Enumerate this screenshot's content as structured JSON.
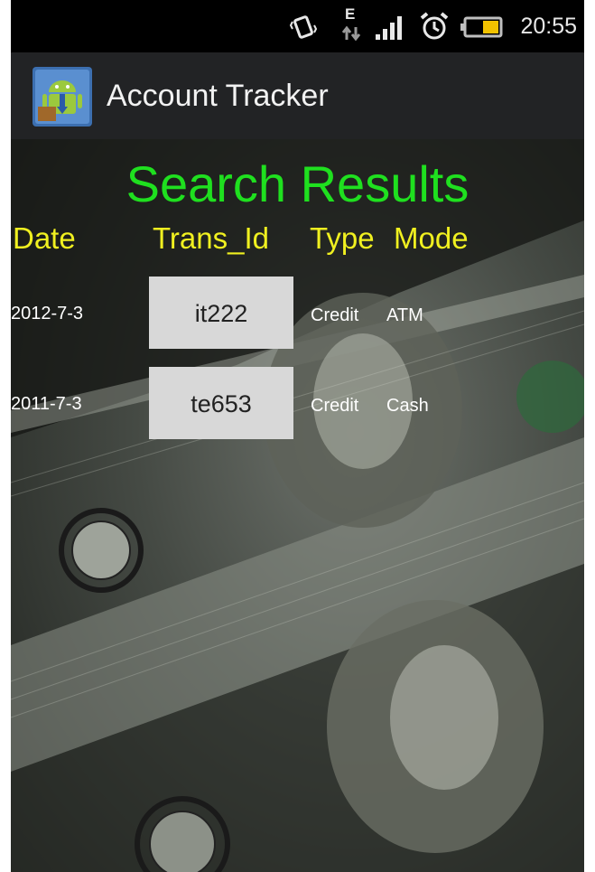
{
  "status_bar": {
    "time": "20:55",
    "icons": [
      "vibrate-icon",
      "edge-data-icon",
      "signal-icon",
      "alarm-icon",
      "battery-icon"
    ],
    "edge_label": "E"
  },
  "action_bar": {
    "app_icon": "android-app-icon",
    "title": "Account Tracker"
  },
  "results": {
    "title": "Search Results",
    "columns": [
      "Date",
      "Trans_Id",
      "Type",
      "Mode"
    ],
    "rows": [
      {
        "date": "2012-7-3",
        "trans_id": "it222",
        "type": "Credit",
        "mode": "ATM"
      },
      {
        "date": "2011-7-3",
        "trans_id": "te653",
        "type": "Credit",
        "mode": "Cash"
      }
    ]
  },
  "colors": {
    "title_green": "#1fe01f",
    "header_yellow": "#f0f020",
    "action_bar": "#222325",
    "button": "#d8d8d8"
  }
}
